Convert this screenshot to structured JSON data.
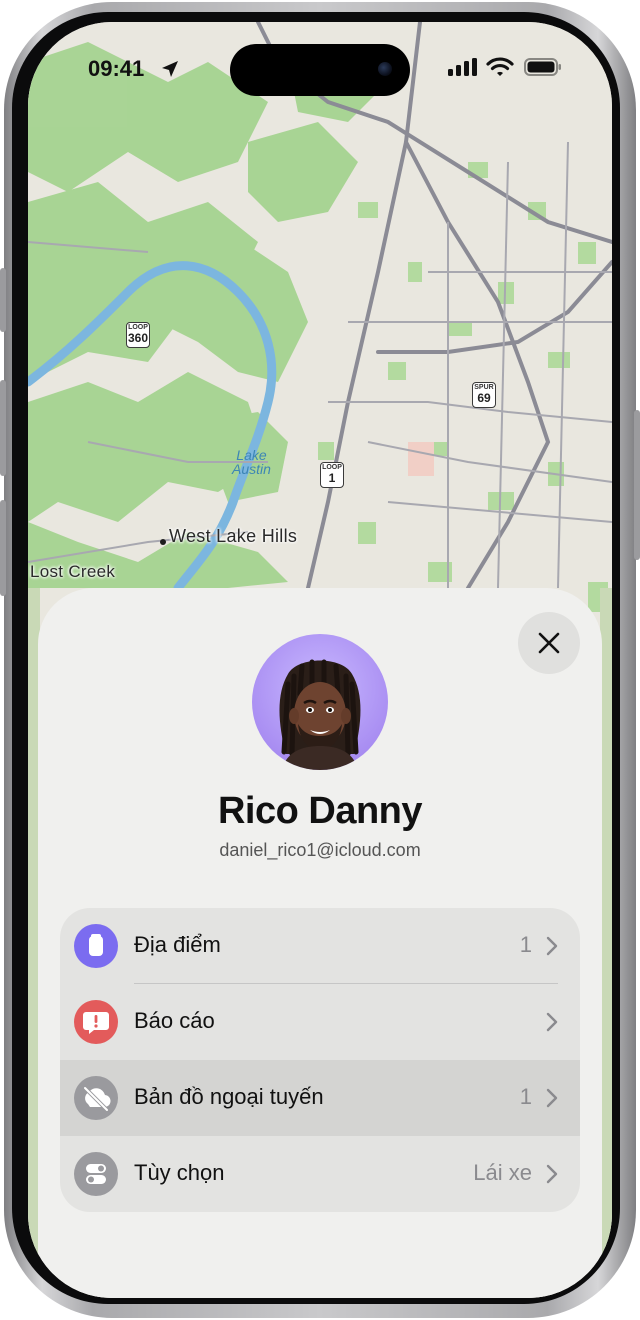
{
  "status_bar": {
    "time": "09:41"
  },
  "map": {
    "places": [
      "West Lake Hills",
      "Lost Creek"
    ],
    "water_label": "Lake\nAustin",
    "shields": [
      {
        "top": "LOOP",
        "number": "360"
      },
      {
        "top": "SPUR",
        "number": "69"
      },
      {
        "top": "LOOP",
        "number": "1"
      }
    ]
  },
  "profile": {
    "name": "Rico Danny",
    "email": "daniel_rico1@icloud.com"
  },
  "menu": {
    "items": [
      {
        "label": "Địa điểm",
        "value": "1",
        "icon": "location-tag-icon",
        "color": "#7b6cf0"
      },
      {
        "label": "Báo cáo",
        "value": "",
        "icon": "report-icon",
        "color": "#e35b5b"
      },
      {
        "label": "Bản đồ ngoại tuyến",
        "value": "1",
        "icon": "offline-map-icon",
        "color": "#9a9a9e"
      },
      {
        "label": "Tùy chọn",
        "value": "Lái xe",
        "icon": "options-toggle-icon",
        "color": "#9a9a9e"
      }
    ]
  },
  "colors": {
    "map_land": "#e9e7df",
    "map_green": "#9fd08a",
    "map_water": "#7cb6df",
    "map_road": "#8b8b95",
    "card_bg": "#f0f0ee"
  }
}
